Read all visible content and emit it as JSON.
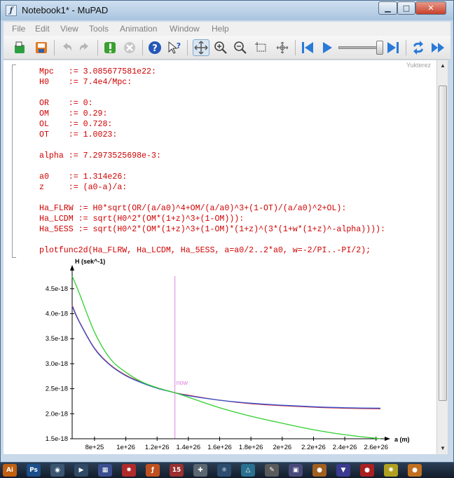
{
  "window": {
    "title": "Notebook1* - MuPAD",
    "app_icon_glyph": "ƒ",
    "min_glyph": "▁",
    "max_glyph": "□",
    "close_glyph": "✕"
  },
  "menu": [
    "File",
    "Edit",
    "View",
    "Tools",
    "Animation",
    "Window",
    "Help"
  ],
  "toolbar": {
    "icons": [
      "open-icon",
      "save-icon",
      "undo-icon",
      "redo-icon",
      "evaluate-icon",
      "stop-icon",
      "help-icon",
      "context-help-icon",
      "move-icon",
      "zoom-in-icon",
      "zoom-out-icon",
      "select-region-icon",
      "rotate-icon",
      "animation-start-icon",
      "animation-play-icon",
      "animation-end-icon",
      "repeat-icon",
      "fast-forward-icon"
    ],
    "animation_slider": 0.95
  },
  "notebook": {
    "watermark": "Yukterez",
    "code_lines": [
      "Mpc   := 3.085677581e22:",
      "H0    := 7.4e4/Mpc:",
      "",
      "OR    := 0:",
      "OM    := 0.29:",
      "OL    := 0.728:",
      "OT    := 1.0023:",
      "",
      "alpha := 7.2973525698e-3:",
      "",
      "a0    := 1.314e26:",
      "z     := (a0-a)/a:",
      "",
      "Ha_FLRW := H0*sqrt(OR/(a/a0)^4+OM/(a/a0)^3+(1-OT)/(a/a0)^2+OL):",
      "Ha_LCDM := sqrt(H0^2*(OM*(1+z)^3+(1-OM))):",
      "Ha_5ESS := sqrt(H0^2*(OM*(1+z)^3+(1-OM)*(1+z)^(3*(1+w*(1+z)^-alpha)))):",
      "",
      "plotfunc2d(Ha_FLRW, Ha_LCDM, Ha_5ESS, a=a0/2..2*a0, w=-2/PI..-PI/2);"
    ]
  },
  "chart_data": {
    "type": "line",
    "ylabel": "H (sek^-1)",
    "xlabel": "a (m)",
    "xlim": [
      6.57e+25,
      2.628e+26
    ],
    "ylim": [
      1.5e-18,
      4.75e-18
    ],
    "x_ticks": [
      8e+25,
      1e+26,
      1.2e+26,
      1.4e+26,
      1.6e+26,
      1.8e+26,
      2e+26,
      2.2e+26,
      2.4e+26,
      2.6e+26
    ],
    "x_tick_labels": [
      "8e+25",
      "1e+26",
      "1.2e+26",
      "1.4e+26",
      "1.6e+26",
      "1.8e+26",
      "2e+26",
      "2.2e+26",
      "2.4e+26",
      "2.6e+26"
    ],
    "y_ticks": [
      1.5e-18,
      2e-18,
      2.5e-18,
      3e-18,
      3.5e-18,
      4e-18,
      4.5e-18
    ],
    "y_tick_labels": [
      "1.5e-18",
      "2.0e-18",
      "2.5e-18",
      "3.0e-18",
      "3.5e-18",
      "4.0e-18",
      "4.5e-18"
    ],
    "annotation": {
      "label": "now",
      "x": 1.314e+26,
      "color": "#e080e0"
    },
    "series": [
      {
        "color": "#e03030",
        "x": [
          6.57e+25,
          7e+25,
          8e+25,
          9e+25,
          1e+26,
          1.1e+26,
          1.2e+26,
          1.314e+26,
          1.4e+26,
          1.6e+26,
          1.8e+26,
          2e+26,
          2.2e+26,
          2.4e+26,
          2.628e+26
        ],
        "y": [
          4.17e-18,
          3.86e-18,
          3.31e-18,
          2.98e-18,
          2.77e-18,
          2.63e-18,
          2.52e-18,
          2.42e-18,
          2.37e-18,
          2.27e-18,
          2.2e-18,
          2.16e-18,
          2.13e-18,
          2.11e-18,
          2.1e-18
        ]
      },
      {
        "color": "#3050d0",
        "x": [
          6.57e+25,
          7e+25,
          8e+25,
          9e+25,
          1e+26,
          1.1e+26,
          1.2e+26,
          1.314e+26,
          1.4e+26,
          1.6e+26,
          1.8e+26,
          2e+26,
          2.2e+26,
          2.4e+26,
          2.628e+26
        ],
        "y": [
          4.15e-18,
          3.85e-18,
          3.3e-18,
          2.97e-18,
          2.76e-18,
          2.62e-18,
          2.51e-18,
          2.42e-18,
          2.36e-18,
          2.27e-18,
          2.21e-18,
          2.17e-18,
          2.14e-18,
          2.12e-18,
          2.11e-18
        ]
      },
      {
        "color": "#30d030",
        "x": [
          6.57e+25,
          7e+25,
          8e+25,
          9e+25,
          1e+26,
          1.1e+26,
          1.2e+26,
          1.314e+26,
          1.4e+26,
          1.6e+26,
          1.8e+26,
          2e+26,
          2.2e+26,
          2.4e+26,
          2.628e+26
        ],
        "y": [
          4.75e-18,
          4.43e-18,
          3.63e-18,
          3.1e-18,
          2.83e-18,
          2.64e-18,
          2.52e-18,
          2.42e-18,
          2.33e-18,
          2.12e-18,
          1.95e-18,
          1.81e-18,
          1.68e-18,
          1.58e-18,
          1.5e-18
        ]
      }
    ]
  },
  "scrollbar": {
    "up_glyph": "▲",
    "down_glyph": "▼"
  },
  "taskbar": {
    "items": [
      {
        "icon": "illustrator-icon",
        "text": "Ai",
        "color": "#c06010"
      },
      {
        "icon": "photoshop-icon",
        "text": "Ps",
        "color": "#1c4f8a"
      },
      {
        "icon": "browser-icon",
        "text": "◉",
        "color": "#3a5570"
      },
      {
        "icon": "media-player-icon",
        "text": "▶",
        "color": "#304a66"
      },
      {
        "icon": "calculator-icon",
        "text": "▦",
        "color": "#3a4f90"
      },
      {
        "icon": "gear-icon",
        "text": "✹",
        "color": "#b02a2a"
      },
      {
        "icon": "mupad-icon",
        "text": "ƒ",
        "color": "#c05020"
      },
      {
        "icon": "calendar-icon",
        "text": "15",
        "color": "#9a3030"
      },
      {
        "icon": "tool-icon",
        "text": "✚",
        "color": "#5a6670"
      },
      {
        "icon": "molecule-icon",
        "text": "⚛",
        "color": "#2d4d6e"
      },
      {
        "icon": "triangle-icon",
        "text": "△",
        "color": "#2a7090"
      },
      {
        "icon": "editor-icon",
        "text": "✎",
        "color": "#5a5a5a"
      },
      {
        "icon": "image-icon",
        "text": "▣",
        "color": "#4a4a7a"
      },
      {
        "icon": "planet-icon",
        "text": "●",
        "color": "#a06020"
      },
      {
        "icon": "shield-icon",
        "text": "▼",
        "color": "#3a3a90"
      },
      {
        "icon": "ball-icon",
        "text": "●",
        "color": "#aa2020"
      },
      {
        "icon": "spinner-icon",
        "text": "✺",
        "color": "#b0a020"
      },
      {
        "icon": "orange-icon",
        "text": "●",
        "color": "#c07020"
      }
    ]
  }
}
